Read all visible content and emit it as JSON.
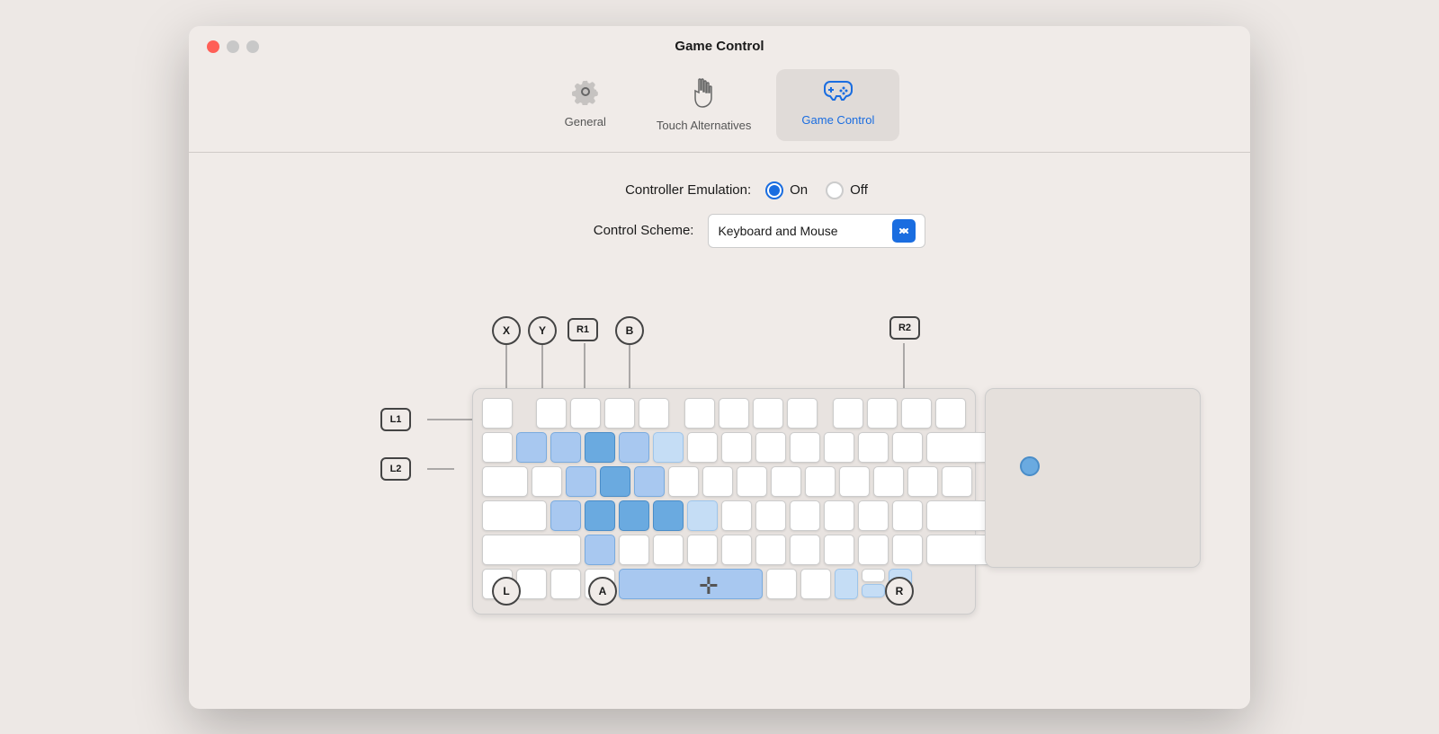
{
  "window": {
    "title": "Game Control",
    "controls": {
      "close": "close",
      "minimize": "minimize",
      "maximize": "maximize"
    }
  },
  "toolbar": {
    "tabs": [
      {
        "id": "general",
        "label": "General",
        "icon": "⚙",
        "active": false
      },
      {
        "id": "touch",
        "label": "Touch Alternatives",
        "icon": "☝",
        "active": false
      },
      {
        "id": "gamecontrol",
        "label": "Game Control",
        "icon": "🎮",
        "active": true
      }
    ]
  },
  "settings": {
    "emulation_label": "Controller Emulation:",
    "emulation_on": "On",
    "emulation_off": "Off",
    "emulation_value": "on",
    "scheme_label": "Control Scheme:",
    "scheme_value": "Keyboard and Mouse"
  },
  "diagram": {
    "labels_top": [
      "X",
      "Y",
      "R1",
      "B",
      "R2"
    ],
    "labels_left": [
      "L1",
      "L2"
    ],
    "labels_bottom": [
      "L",
      "A",
      "R"
    ],
    "dpad": "✛"
  }
}
